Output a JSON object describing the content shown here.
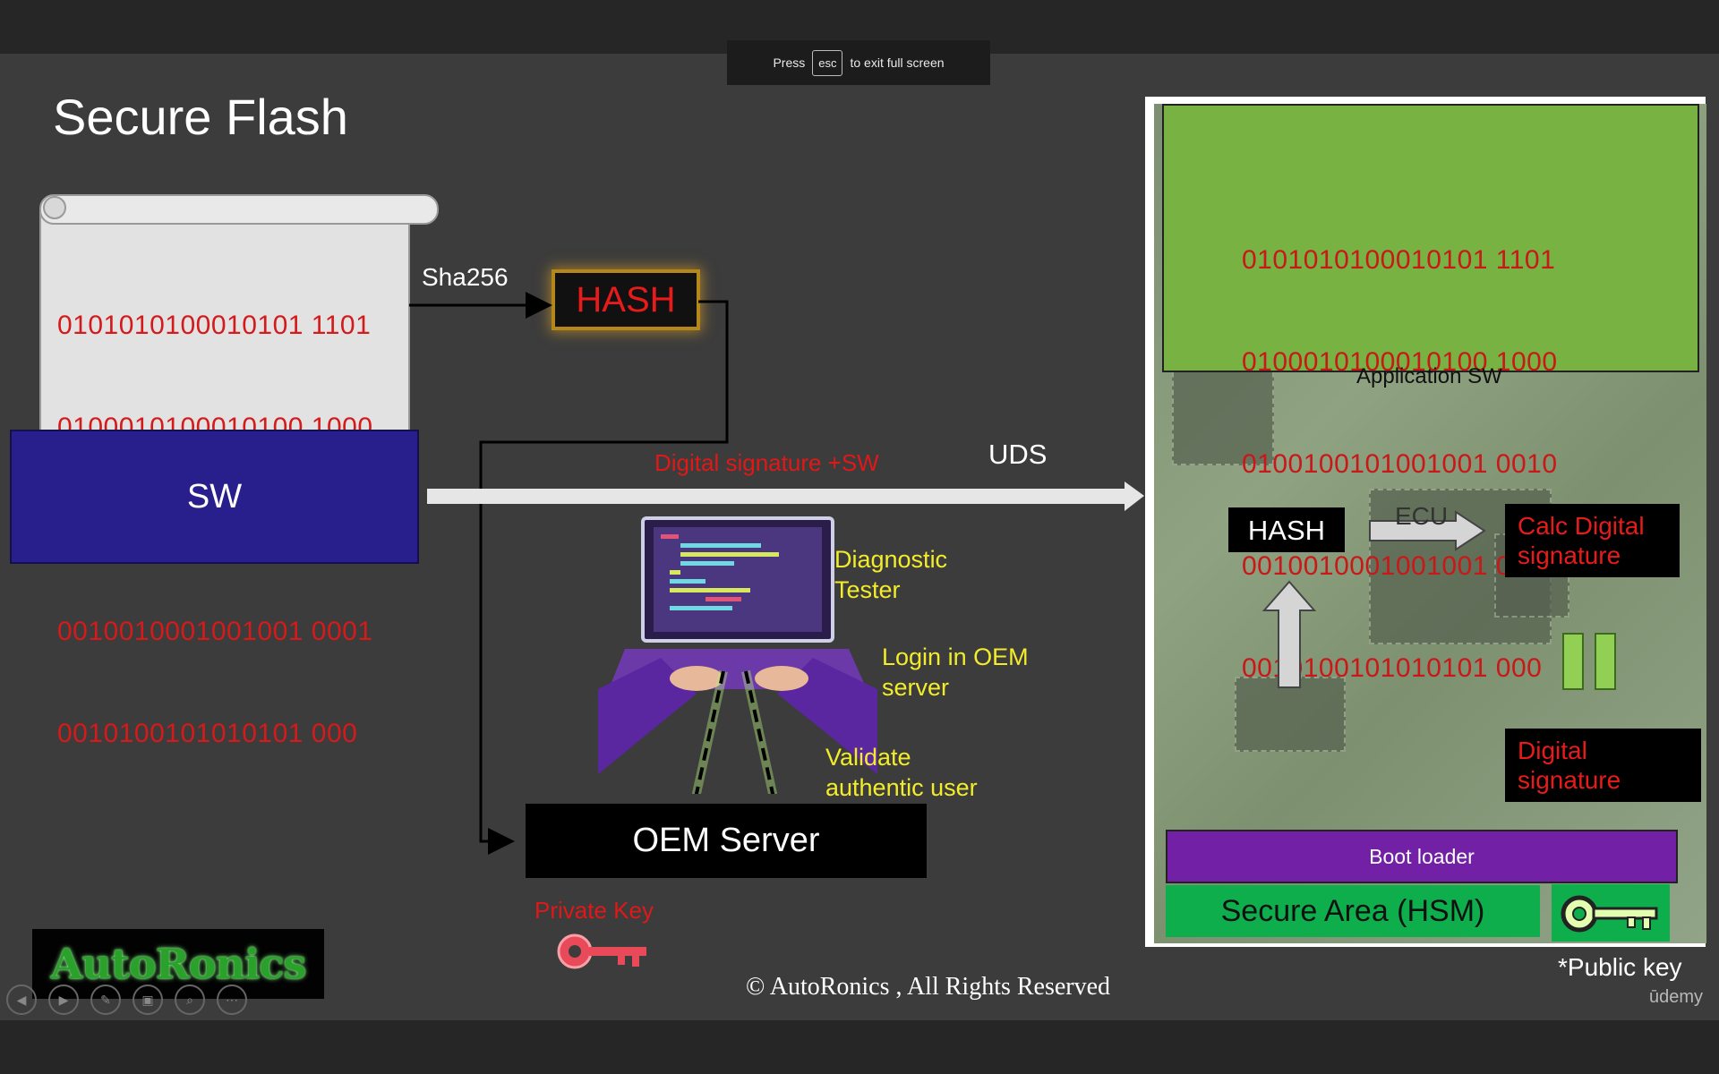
{
  "viewer": {
    "esc_press": "Press",
    "esc_key": "esc",
    "esc_suffix": "to exit full screen",
    "udemy": "ūdemy"
  },
  "slide": {
    "title": "Secure Flash",
    "binary_lines": [
      "0101010100010101 1101",
      "0100010100010100 1000",
      "0100100101001001 0010",
      "0010010001001001 0001",
      "0010100101010101 000"
    ],
    "sha_label": "Sha256",
    "hash_label": "HASH",
    "sw_label": "SW",
    "digital_signature_sw": "Digital signature +SW",
    "uds_label": "UDS",
    "diagnostic_tester": [
      "Diagnostic",
      "Tester"
    ],
    "login_oem": [
      "Login in OEM",
      "server"
    ],
    "validate_user": [
      "Validate",
      "authentic user"
    ],
    "oem_server": "OEM Server",
    "private_key": "Private Key",
    "ecu": {
      "app_sw_label": "Application SW",
      "hash_label": "HASH",
      "ecu_arrow_text": "ECU",
      "calc_digital_signature": [
        "Calc Digital",
        "signature"
      ],
      "digital_signature": [
        "Digital",
        "signature"
      ],
      "boot_loader": "Boot loader",
      "secure_area": "Secure Area (HSM)",
      "public_key": "*Public key"
    },
    "logo_text": "AutoRonics",
    "copyright": "© AutoRonics , All Rights Reserved"
  },
  "colors": {
    "binary_red": "#d41a1a",
    "sw_blue": "#281e8c",
    "app_green": "#77b243",
    "bootloader_purple": "#7221a6",
    "hsm_green": "#0fae4c",
    "tester_yellow": "#f3ec2a"
  },
  "icons": {
    "private_key": "key-icon",
    "public_key": "key-icon",
    "laptop": "laptop-icon"
  }
}
